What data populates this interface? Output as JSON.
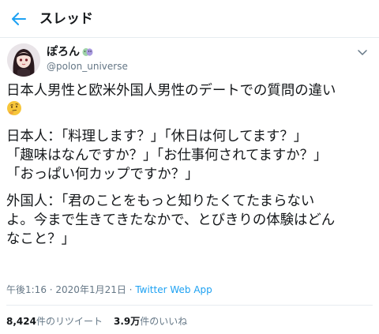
{
  "header": {
    "title": "スレッド"
  },
  "author": {
    "display_name": "ぽろん",
    "handle": "@polon_universe"
  },
  "tweet": {
    "lines": [
      "日本人男性と欧米外国人男性のデートでの質問の違い",
      "",
      "日本人：「料理します？」「休日は何してます？」",
      "「趣味はなんですか？」「お仕事何されてますか？」",
      "「おっぱい何カップですか？」",
      "外国人：「君のことをもっと知りたくてたまらない",
      "よ。今まで生きてきたなかで、とびきりの体験はどん",
      "なこと？」"
    ]
  },
  "meta": {
    "time": "午後1:16",
    "separator": " · ",
    "date": "2020年1月21日",
    "source": "Twitter Web App"
  },
  "stats": {
    "retweets_count": "8,424",
    "retweets_label": "件のリツイート",
    "likes_count": "3.9万",
    "likes_label": "件のいいね"
  },
  "colors": {
    "accent": "#1da1f2",
    "muted": "#657786",
    "text": "#14171a"
  }
}
